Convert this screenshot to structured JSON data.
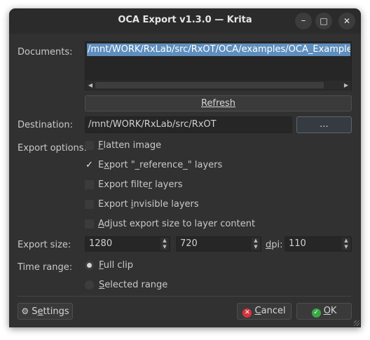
{
  "window": {
    "title": "OCA Export  v1.3.0 — Krita",
    "minimize_glyph": "–",
    "maximize_glyph": "□",
    "close_glyph": "✕"
  },
  "documents": {
    "label": "Documents:",
    "items": [
      "/mnt/WORK/RxLab/src/RxOT/OCA/examples/OCA_Example_Bird"
    ],
    "refresh_label": "Refresh"
  },
  "destination": {
    "label": "Destination:",
    "value": "/mnt/WORK/RxLab/src/RxOT",
    "browse_label": "..."
  },
  "export_options": {
    "label": "Export options:",
    "options": [
      {
        "label": "Flatten image",
        "checked": false
      },
      {
        "label": "Export \"_reference_\" layers",
        "checked": true
      },
      {
        "label": "Export filter layers",
        "checked": false
      },
      {
        "label": "Export invisible layers",
        "checked": false
      },
      {
        "label": "Adjust export size to layer content",
        "checked": false
      }
    ]
  },
  "export_size": {
    "label": "Export size:",
    "width": "1280",
    "height": "720",
    "dpi_label": "dpi:",
    "dpi": "110"
  },
  "time_range": {
    "label": "Time range:",
    "full_clip": "Full clip",
    "selected_range": "Selected range",
    "selected": "full_clip"
  },
  "footer": {
    "settings_label": "Settings",
    "cancel_label": "Cancel",
    "ok_label": "OK"
  },
  "colors": {
    "accent": "#5e8ebd",
    "cancel_icon": "#d9333f",
    "ok_icon": "#39a845"
  }
}
